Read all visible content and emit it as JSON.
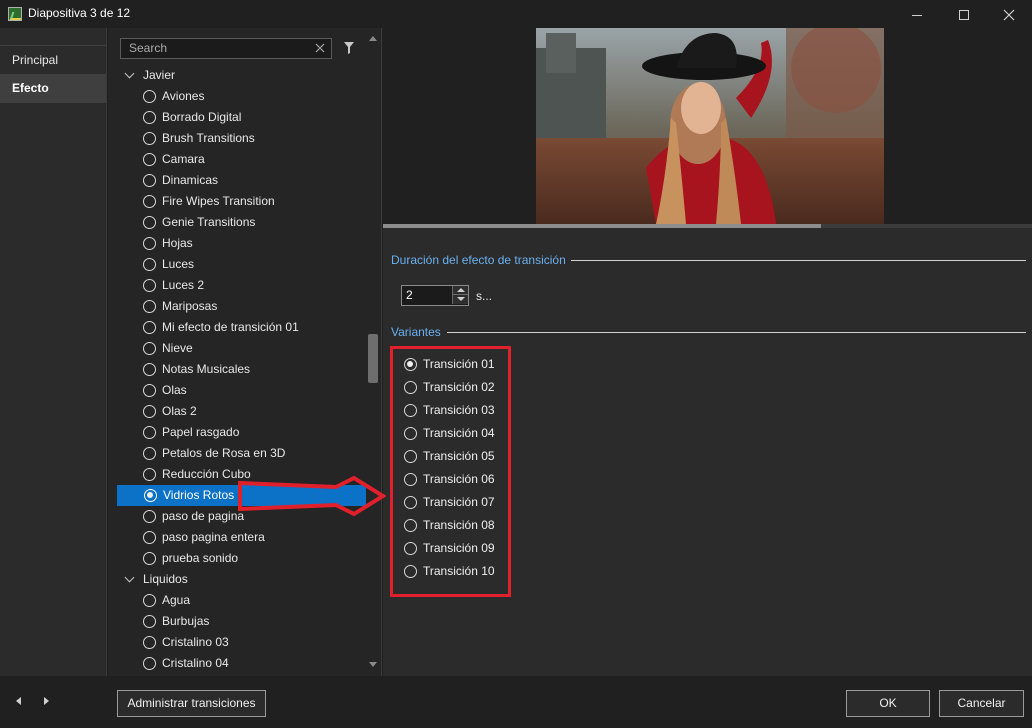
{
  "window": {
    "title": "Diapositiva 3 de 12"
  },
  "leftnav": {
    "items": [
      {
        "label": "Principal"
      },
      {
        "label": "Efecto"
      }
    ]
  },
  "search": {
    "placeholder": "Search"
  },
  "tree": {
    "groups": [
      {
        "label": "Javier",
        "items": [
          {
            "label": "Aviones",
            "selected": false
          },
          {
            "label": "Borrado Digital",
            "selected": false
          },
          {
            "label": "Brush Transitions",
            "selected": false
          },
          {
            "label": "Camara",
            "selected": false
          },
          {
            "label": "Dinamicas",
            "selected": false
          },
          {
            "label": "Fire Wipes Transition",
            "selected": false
          },
          {
            "label": "Genie Transitions",
            "selected": false
          },
          {
            "label": "Hojas",
            "selected": false
          },
          {
            "label": "Luces",
            "selected": false
          },
          {
            "label": "Luces 2",
            "selected": false
          },
          {
            "label": "Mariposas",
            "selected": false
          },
          {
            "label": "Mi efecto de transición 01",
            "selected": false
          },
          {
            "label": "Nieve",
            "selected": false
          },
          {
            "label": "Notas Musicales",
            "selected": false
          },
          {
            "label": "Olas",
            "selected": false
          },
          {
            "label": "Olas 2",
            "selected": false
          },
          {
            "label": "Papel rasgado",
            "selected": false
          },
          {
            "label": "Petalos de Rosa en 3D",
            "selected": false
          },
          {
            "label": "Reducción Cubo",
            "selected": false
          },
          {
            "label": "Vidrios Rotos",
            "selected": true
          },
          {
            "label": "paso de pagina",
            "selected": false
          },
          {
            "label": "paso pagina entera",
            "selected": false
          },
          {
            "label": "prueba sonido",
            "selected": false
          }
        ]
      },
      {
        "label": "Liquidos",
        "items": [
          {
            "label": "Agua",
            "selected": false
          },
          {
            "label": "Burbujas",
            "selected": false
          },
          {
            "label": "Cristalino 03",
            "selected": false
          },
          {
            "label": "Cristalino 04",
            "selected": false
          }
        ]
      }
    ]
  },
  "preview": {
    "progress": 0.675
  },
  "duration": {
    "label": "Duración del efecto de transición",
    "value": "2",
    "unit": "s..."
  },
  "variants": {
    "label": "Variantes",
    "items": [
      {
        "label": "Transición 01",
        "selected": true
      },
      {
        "label": "Transición 02",
        "selected": false
      },
      {
        "label": "Transición 03",
        "selected": false
      },
      {
        "label": "Transición 04",
        "selected": false
      },
      {
        "label": "Transición 05",
        "selected": false
      },
      {
        "label": "Transición 06",
        "selected": false
      },
      {
        "label": "Transición 07",
        "selected": false
      },
      {
        "label": "Transición 08",
        "selected": false
      },
      {
        "label": "Transición 09",
        "selected": false
      },
      {
        "label": "Transición 10",
        "selected": false
      }
    ]
  },
  "footer": {
    "manage_label": "Administrar transiciones",
    "ok_label": "OK",
    "cancel_label": "Cancelar"
  },
  "colors": {
    "accent": "#0b72c7",
    "highlight": "#e0202a",
    "section_label": "#6ab0f0"
  }
}
